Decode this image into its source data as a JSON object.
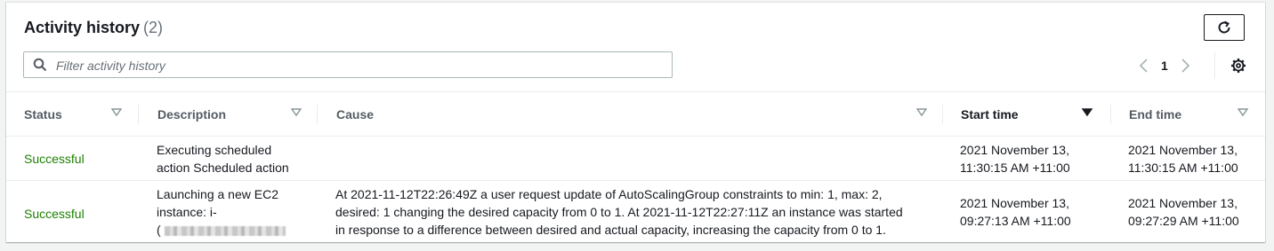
{
  "header": {
    "title": "Activity history",
    "count": "(2)"
  },
  "filter": {
    "placeholder": "Filter activity history",
    "value": ""
  },
  "pagination": {
    "current_page": "1"
  },
  "table": {
    "columns": [
      {
        "key": "status",
        "label": "Status"
      },
      {
        "key": "description",
        "label": "Description"
      },
      {
        "key": "cause",
        "label": "Cause"
      },
      {
        "key": "start_time",
        "label": "Start time"
      },
      {
        "key": "end_time",
        "label": "End time"
      }
    ],
    "sorted_by": "start_time",
    "rows": [
      {
        "status": "Successful",
        "description_line1": "Executing scheduled",
        "description_line2": "action Scheduled action",
        "cause": "",
        "start_time_line1": "2021 November 13,",
        "start_time_line2": "11:30:15 AM +11:00",
        "end_time_line1": "2021 November 13,",
        "end_time_line2": "11:30:15 AM +11:00"
      },
      {
        "status": "Successful",
        "description_line1": "Launching a new EC2",
        "description_line2": "instance: i-",
        "description_line3": "(",
        "cause_line1": "At 2021-11-12T22:26:49Z a user request update of AutoScalingGroup constraints to min: 1, max: 2,",
        "cause_line2": "desired: 1 changing the desired capacity from 0 to 1. At 2021-11-12T22:27:11Z an instance was started",
        "cause_line3": "in response to a difference between desired and actual capacity, increasing the capacity from 0 to 1.",
        "start_time_line1": "2021 November 13,",
        "start_time_line2": "09:27:13 AM +11:00",
        "end_time_line1": "2021 November 13,",
        "end_time_line2": "09:27:29 AM +11:00"
      }
    ]
  },
  "colors": {
    "success": "#1d8102",
    "border": "#eaeded",
    "muted": "#687078"
  },
  "icons": [
    "refresh-icon",
    "search-icon",
    "chevron-left-icon",
    "chevron-right-icon",
    "gear-icon",
    "sort-icon",
    "sort-desc-icon"
  ]
}
